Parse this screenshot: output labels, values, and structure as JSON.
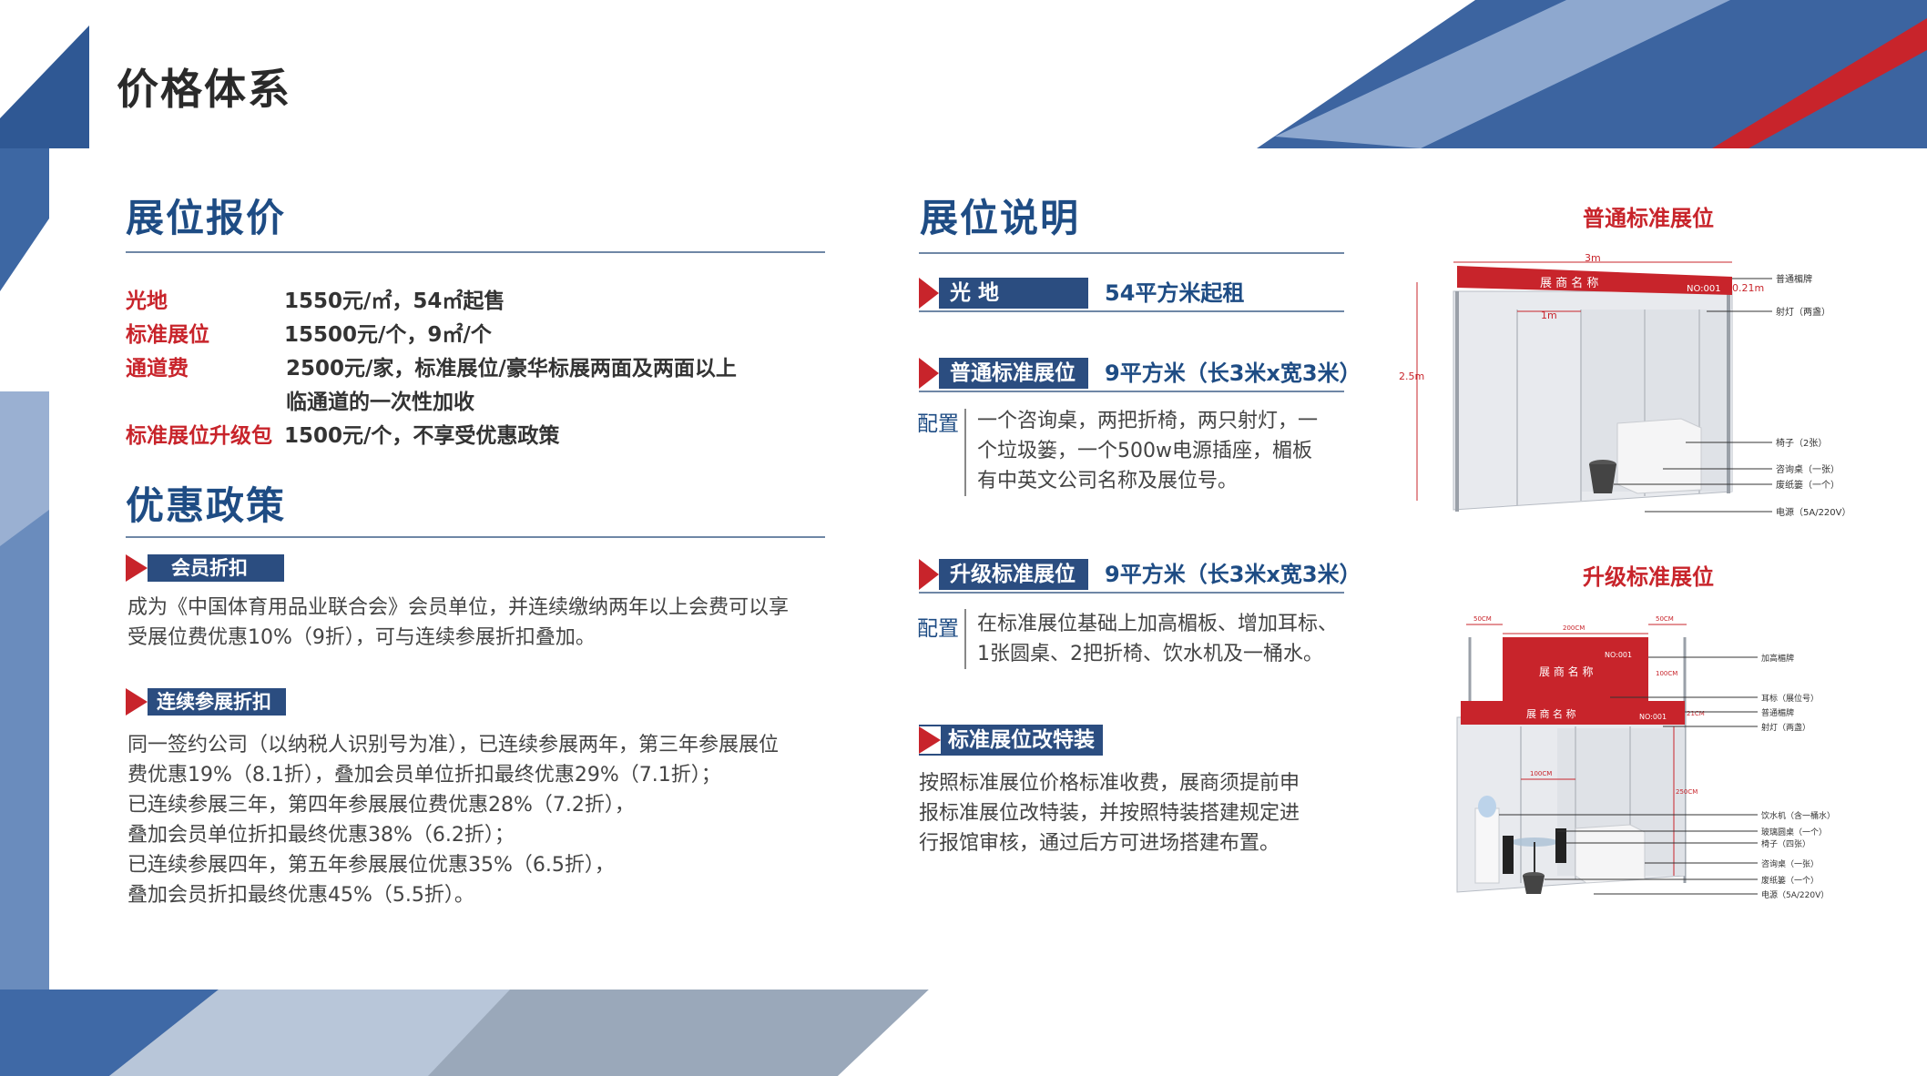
{
  "page_title": "价格体系",
  "pricing": {
    "heading": "展位报价",
    "rows": [
      {
        "label": "光地",
        "value": "1550元/㎡，54㎡起售"
      },
      {
        "label": "标准展位",
        "value": "15500元/个，9㎡/个"
      },
      {
        "label": "通道费",
        "value": "2500元/家，标准展位/豪华标展两面及两面以上"
      },
      {
        "label": "",
        "value": "临通道的一次性加收"
      },
      {
        "label": "标准展位升级包",
        "value": "1500元/个，不享受优惠政策"
      }
    ]
  },
  "discounts": {
    "heading": "优惠政策",
    "member_tag": "会员折扣",
    "member_lines": [
      "成为《中国体育用品业联合会》会员单位，并连续缴纳两年以上会费可以享",
      "受展位费优惠10%（9折），可与连续参展折扣叠加。"
    ],
    "continuous_tag": "连续参展折扣",
    "continuous_lines": [
      "同一签约公司（以纳税人识别号为准），已连续参展两年，第三年参展展位",
      "费优惠19%（8.1折），叠加会员单位折扣最终优惠29%（7.1折）；",
      "已连续参展三年，第四年参展展位费优惠28%（7.2折），",
      "叠加会员单位折扣最终优惠38%（6.2折）；",
      "已连续参展四年，第五年参展展位优惠35%（6.5折），",
      "叠加会员折扣最终优惠45%（5.5折）。"
    ]
  },
  "booth_info": {
    "heading": "展位说明",
    "space": {
      "tag": "光  地",
      "spec": "54平方米起租"
    },
    "standard": {
      "tag": "普通标准展位",
      "spec": "9平方米（长3米x宽3米）",
      "config_label": "配置",
      "config_lines": [
        "一个咨询桌，两把折椅，两只射灯，一",
        "个垃圾篓，一个500w电源插座，楣板",
        "有中英文公司名称及展位号。"
      ]
    },
    "upgraded": {
      "tag": "升级标准展位",
      "spec": "9平方米（长3米x宽3米）",
      "config_label": "配置",
      "config_lines": [
        "在标准展位基础上加高楣板、增加耳标、",
        "1张圆桌、2把折椅、饮水机及一桶水。"
      ]
    },
    "custom": {
      "tag": "标准展位改特装",
      "lines": [
        "按照标准展位价格标准收费，展商须提前申",
        "报标准展位改特装，并按照特装搭建规定进",
        "行报馆审核，通过后方可进场搭建布置。"
      ]
    }
  },
  "diagrams": {
    "standard": {
      "title": "普通标准展位",
      "width_label": "3m",
      "panel_label": "1m",
      "height_label": "2.5m",
      "fascia_height_label": "0.21m",
      "company_name": "展 商 名 称",
      "booth_no": "NO:001",
      "callouts": [
        "普通楣牌",
        "射灯（两盏）",
        "椅子（2张）",
        "咨询桌（一张）",
        "废纸篓（一个）",
        "电源（5A/220V）"
      ]
    },
    "upgraded": {
      "title": "升级标准展位",
      "top_labels": [
        "50CM",
        "200CM",
        "50CM"
      ],
      "panel_label": "100CM",
      "height_label": "100CM",
      "full_height_label": "250CM",
      "fascia_height_label": "21CM",
      "company_name": "展 商 名 称",
      "booth_no": "NO:001",
      "callouts": [
        "加高楣牌",
        "耳标（展位号）",
        "普通楣牌",
        "射灯（两盏）",
        "饮水机（含一桶水）",
        "玻璃圆桌（一个）",
        "椅子（四张）",
        "咨询桌（一张）",
        "废纸篓（一个）",
        "电源（5A/220V）"
      ]
    }
  },
  "colors": {
    "accent_blue": "#1e4c84",
    "accent_red": "#c8242b",
    "tag_blue": "#2b4d80"
  }
}
